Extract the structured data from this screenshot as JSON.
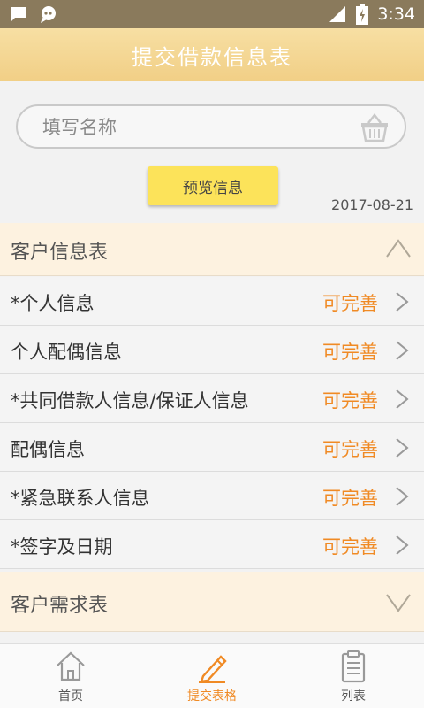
{
  "status_bar": {
    "time": "3:34"
  },
  "header": {
    "title": "提交借款信息表"
  },
  "search": {
    "placeholder": "填写名称"
  },
  "preview_button": {
    "label": "预览信息"
  },
  "date": "2017-08-21",
  "sections": [
    {
      "title": "客户信息表",
      "expanded": true
    },
    {
      "title": "客户需求表",
      "expanded": false
    }
  ],
  "rows": [
    {
      "label": "*个人信息",
      "status": "可完善"
    },
    {
      "label": "个人配偶信息",
      "status": "可完善"
    },
    {
      "label": "*共同借款人信息/保证人信息",
      "status": "可完善"
    },
    {
      "label": "配偶信息",
      "status": "可完善"
    },
    {
      "label": "*紧急联系人信息",
      "status": "可完善"
    },
    {
      "label": "*签字及日期",
      "status": "可完善"
    }
  ],
  "tabs": [
    {
      "label": "首页",
      "icon": "home-icon",
      "active": false
    },
    {
      "label": "提交表格",
      "icon": "pencil-icon",
      "active": true
    },
    {
      "label": "列表",
      "icon": "clipboard-icon",
      "active": false
    }
  ],
  "colors": {
    "accent": "#f08a24",
    "header": "#f3d58f",
    "button": "#fce35a"
  }
}
